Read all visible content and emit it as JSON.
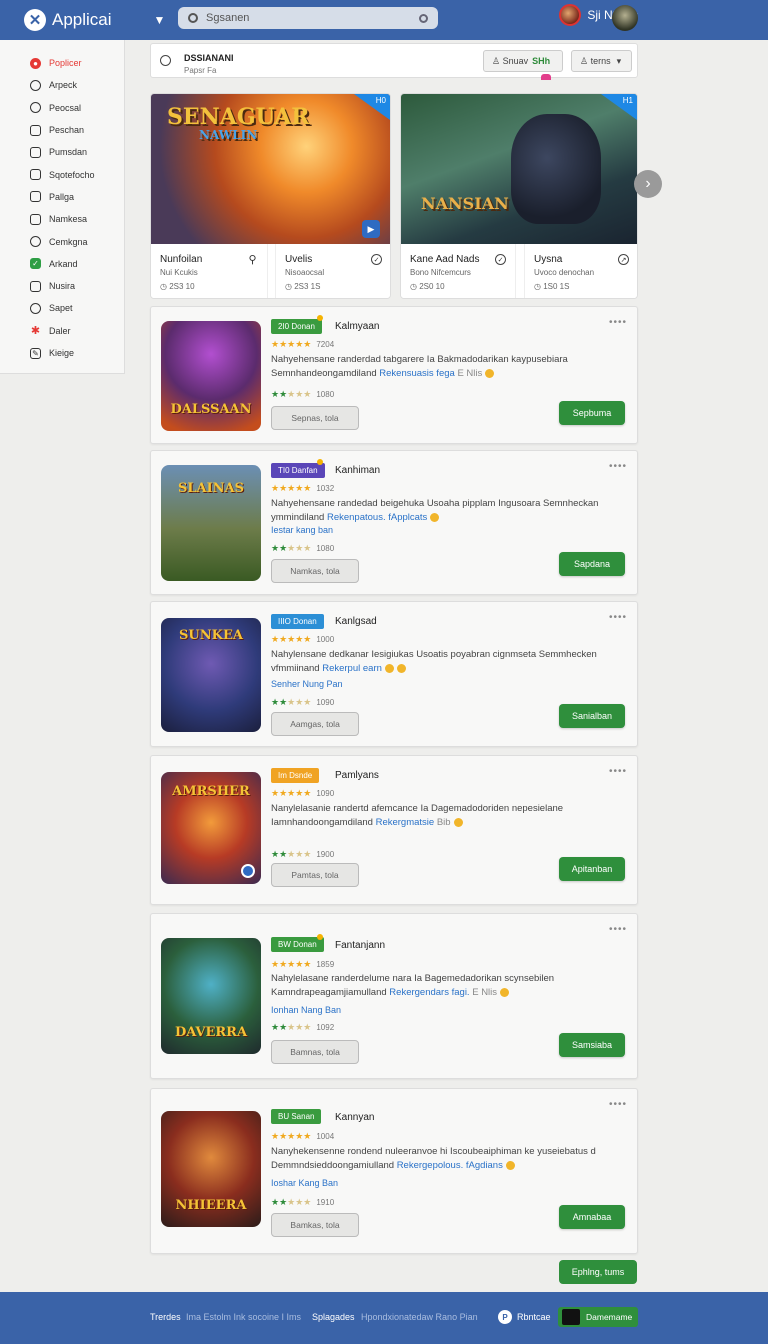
{
  "header": {
    "app_name": "Applicai",
    "search_placeholder": "Sgsanen",
    "user_name": "Sji Ntalns"
  },
  "sidebar": {
    "items": [
      {
        "label": "Poplicer",
        "icon": "popular-icon"
      },
      {
        "label": "Arpeck",
        "icon": "arcade-icon"
      },
      {
        "label": "Peocsal",
        "icon": "social-icon"
      },
      {
        "label": "Peschan",
        "icon": "action-icon"
      },
      {
        "label": "Pumsdan",
        "icon": "board-icon"
      },
      {
        "label": "Sqotefocho",
        "icon": "sports-icon"
      },
      {
        "label": "Pallga",
        "icon": "puzzle-icon"
      },
      {
        "label": "Namkesa",
        "icon": "news-icon"
      },
      {
        "label": "Cemkgna",
        "icon": "gaming-icon"
      },
      {
        "label": "Arkand",
        "icon": "check-icon"
      },
      {
        "label": "Nusira",
        "icon": "music-icon"
      },
      {
        "label": "Sapet",
        "icon": "circle-icon"
      },
      {
        "label": "Daler",
        "icon": "star-icon"
      },
      {
        "label": "Kieige",
        "icon": "edit-icon"
      }
    ]
  },
  "filter": {
    "title": "DSSIANANI",
    "subtitle": "Papsr Fa",
    "chip1_label": "Snuav",
    "chip1_highlight": "SHh",
    "chip2_label": "terns"
  },
  "featured": [
    {
      "art_title": "SENAGUAR",
      "art_sub": "NAWLIN",
      "badge": "H0",
      "left_name": "Nunfoilan",
      "left_sub": "Nui Kcukis",
      "left_stat": "2S3 10",
      "right_name": "Uvelis",
      "right_sub": "Nisoaocsal",
      "right_stat": "2S3 1S"
    },
    {
      "art_title": "NANSIAN",
      "art_sub": "",
      "badge": "H1",
      "left_name": "Kane Aad Nads",
      "left_sub": "Bono Nifcemcurs",
      "left_stat": "2S0 10",
      "right_name": "Uysna",
      "right_sub": "Uvoco denochan",
      "right_stat": "1S0 1S"
    }
  ],
  "games": [
    {
      "tag": "2I0 Donan",
      "tag_color": "#3a9b3f",
      "title": "Kalmyaan",
      "rating_count": "7204",
      "desc": "Nahyehensane randerdad tabgarere Ia Bakmadodarikan kaypusebiara Semnhandeongamdiland",
      "desc_link": "Rekensuasis fega",
      "desc_tail": "E Nlis",
      "extra_link": "",
      "count2": "1080",
      "secondary": "Sepnas, tola",
      "primary": "Sepbuma",
      "art": "DALSSAAN"
    },
    {
      "tag": "TI0 Danfan",
      "tag_color": "#5a46b8",
      "title": "Kanhiman",
      "rating_count": "1032",
      "desc": "Nahyehensane randedad beigehuka Usoaha pipplam Ingusoara Semnheckan ymmindiland",
      "desc_link": "Rekenpatous. fApplcats",
      "desc_tail": "",
      "extra_link": "Iestar kang ban",
      "count2": "1080",
      "secondary": "Namkas, tola",
      "primary": "Sapdana",
      "art": "SLAINAS"
    },
    {
      "tag": "IIIO Donan",
      "tag_color": "#2c8fd6",
      "title": "Kanlgsad",
      "rating_count": "1000",
      "desc": "Nahylensane dedkanar Iesigiukas Usoatis poyabran cignmseta Semmhecken vfmmiinand",
      "desc_link": "Rekerpul earn",
      "desc_tail": "",
      "extra_link": "Senher Nung Pan",
      "count2": "1090",
      "secondary": "Aamgas, tola",
      "primary": "Sanialban",
      "art": "SUNKEA"
    },
    {
      "tag": "Im Dsnde",
      "tag_color": "#f0a323",
      "title": "Pamlyans",
      "rating_count": "1090",
      "desc": "Nanylelasanie randertd afemcance Ia Dagemadodoriden nepesielane Iamnhandoongamdiland",
      "desc_link": "Rekergmatsie",
      "desc_tail": "Bib",
      "extra_link": "",
      "count2": "1900",
      "secondary": "Pamtas, tola",
      "primary": "Apitanban",
      "art": "AMRSHER"
    },
    {
      "tag": "BW Donan",
      "tag_color": "#3a9b3f",
      "title": "Fantanjann",
      "rating_count": "1859",
      "desc": "Nahylelasane randerdelume nara Ia Bagemedadorikan scynsebilen Kamndrapeagamjiamulland",
      "desc_link": "Rekergendars fagi.",
      "desc_tail": "E Nlis",
      "extra_link": "Ionhan Nang Ban",
      "count2": "1092",
      "secondary": "Bamnas, tola",
      "primary": "Samsiaba",
      "art": "DAVERRA"
    },
    {
      "tag": "BU Sanan",
      "tag_color": "#3a9b3f",
      "title": "Kannyan",
      "rating_count": "1004",
      "desc": "Nanyhekensenne rondend nuleeranvoe hi Iscoubeaiphiman ke yuseiebatus d Demmndsieddoongamiulland",
      "desc_link": "Rekergepolous. fAgdians",
      "desc_tail": "",
      "extra_link": "Ioshar Kang Ban",
      "count2": "1910",
      "secondary": "Bamkas, tola",
      "primary": "Amnabaa",
      "art": "NHIEERA"
    }
  ],
  "load_more": "Ephlng, tums",
  "footer": {
    "t1": "Trerdes",
    "t2": "Ima Estolm Ink socoine I Ims",
    "t3": "Splagades",
    "t4": "Hpondxionatedaw Rano Pian",
    "t5": "Rbntcae",
    "t6": "Damemame"
  }
}
